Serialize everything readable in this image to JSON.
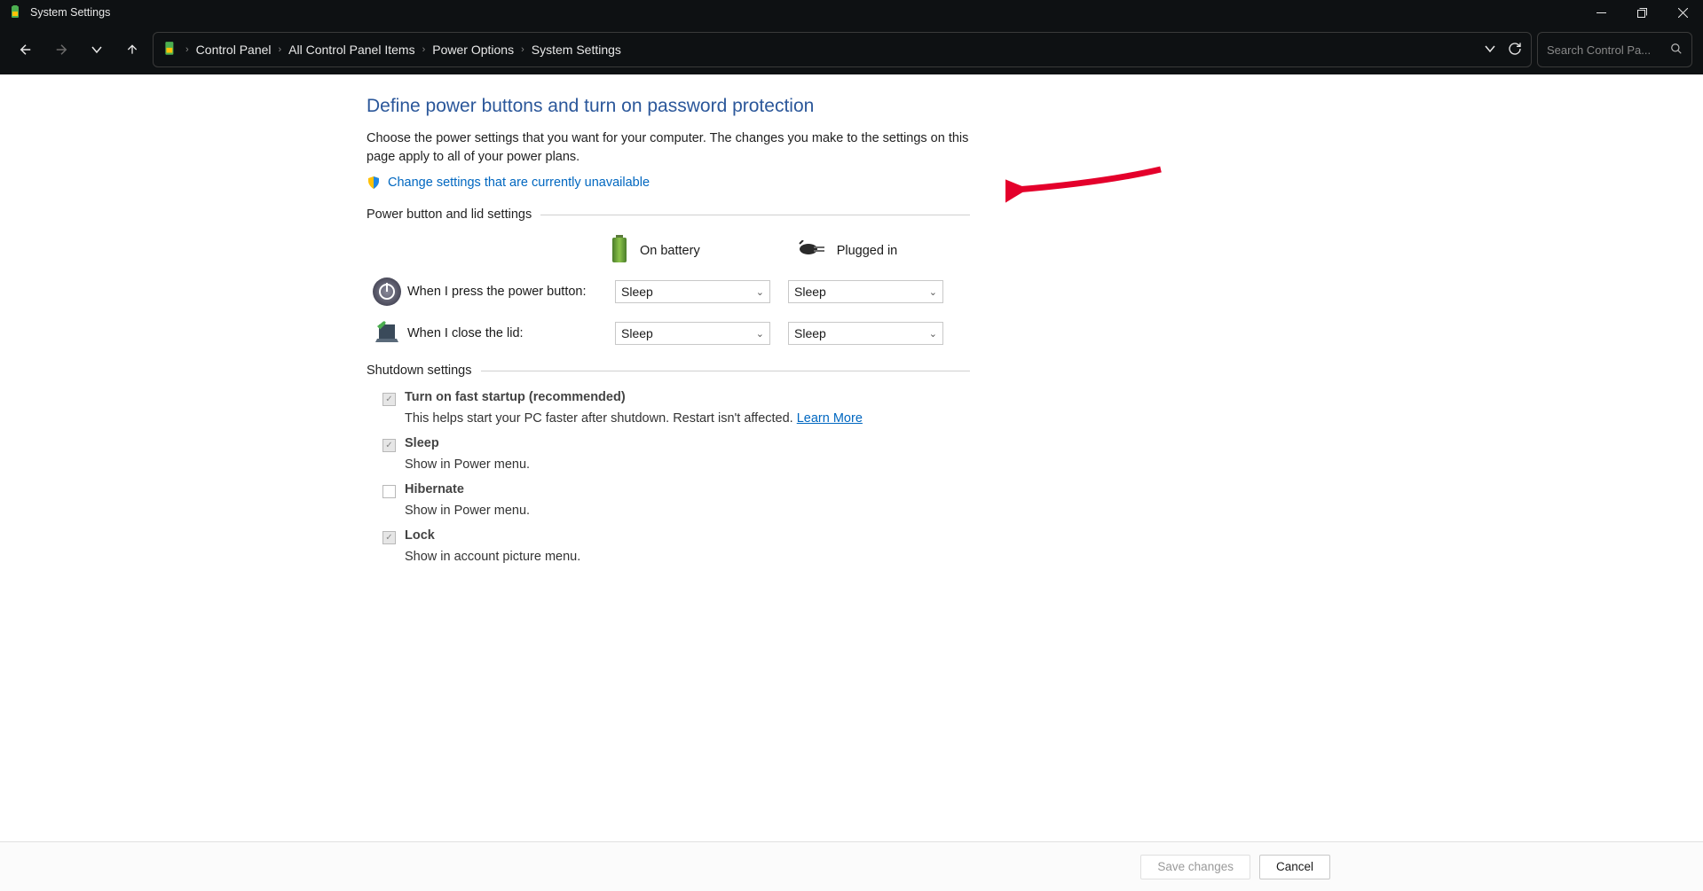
{
  "window": {
    "title": "System Settings"
  },
  "breadcrumbs": {
    "c0": "Control Panel",
    "c1": "All Control Panel Items",
    "c2": "Power Options",
    "c3": "System Settings"
  },
  "search": {
    "placeholder": "Search Control Pa..."
  },
  "page": {
    "heading": "Define power buttons and turn on password protection",
    "description": "Choose the power settings that you want for your computer. The changes you make to the settings on this page apply to all of your power plans.",
    "change_link": "Change settings that are currently unavailable"
  },
  "sections": {
    "power_btn": "Power button and lid settings",
    "shutdown": "Shutdown settings"
  },
  "columns": {
    "battery": "On battery",
    "plugged": "Plugged in"
  },
  "rows": {
    "press": {
      "label": "When I press the power button:",
      "bat": "Sleep",
      "plug": "Sleep"
    },
    "lid": {
      "label": "When I close the lid:",
      "bat": "Sleep",
      "plug": "Sleep"
    }
  },
  "shutdown": {
    "fast": {
      "label": "Turn on fast startup (recommended)",
      "desc": "This helps start your PC faster after shutdown. Restart isn't affected. ",
      "learn": "Learn More"
    },
    "sleep": {
      "label": "Sleep",
      "desc": "Show in Power menu."
    },
    "hibernate": {
      "label": "Hibernate",
      "desc": "Show in Power menu."
    },
    "lock": {
      "label": "Lock",
      "desc": "Show in account picture menu."
    }
  },
  "buttons": {
    "save": "Save changes",
    "cancel": "Cancel"
  }
}
